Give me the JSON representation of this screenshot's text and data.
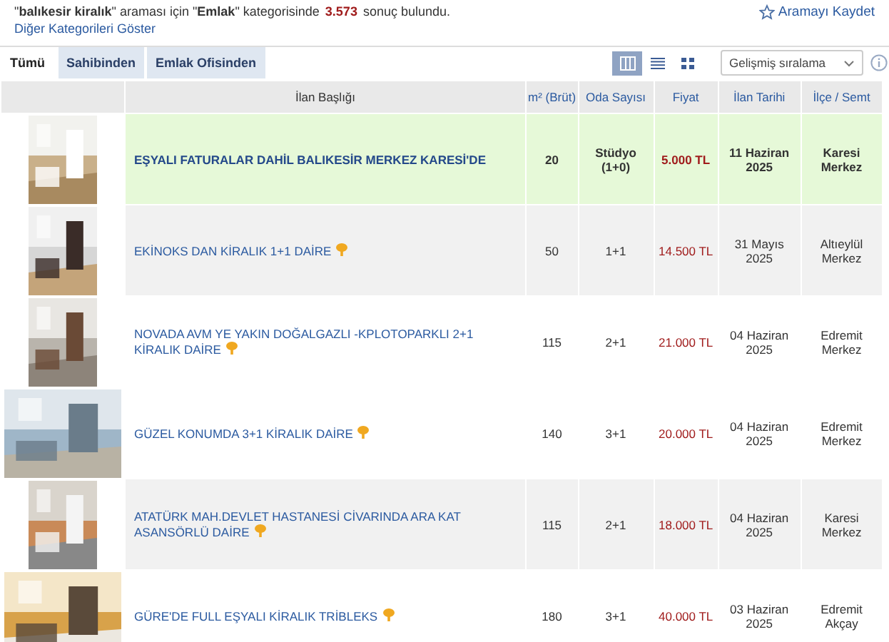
{
  "summary": {
    "text": "\"**balıkesir kiralık**\" araması için \"**Emlak**\" kategorisinde",
    "count": "3.573",
    "suffix": "sonuç bulundu.",
    "link": "Diğer Kategorileri Göster",
    "save": "Aramayı Kaydet"
  },
  "tabs": [
    {
      "label": "Tümü",
      "selected": true
    },
    {
      "label": "Sahibinden",
      "selected": false
    },
    {
      "label": "Emlak Ofisinden",
      "selected": false
    }
  ],
  "views": [
    {
      "kind": "table",
      "selected": true
    },
    {
      "kind": "list",
      "selected": false
    },
    {
      "kind": "grid",
      "selected": false
    }
  ],
  "sort": {
    "value": "Gelişmiş sıralama"
  },
  "table": {
    "columns": [
      "İlan Başlığı",
      "m² (Brüt)",
      "Oda Sayısı",
      "Fiyat",
      "İlan Tarihi",
      "İlçe / Semt"
    ],
    "rows": [
      {
        "featured": true,
        "title": "EŞYALI FATURALAR DAHİL BALIKESİR MERKEZ KARESİ'DE",
        "pinned": false,
        "area": "20",
        "rooms": "Stüdyo (1+0)",
        "price": "5.000 TL",
        "date": "11 Haziran 2025",
        "district": "Karesi Merkez"
      },
      {
        "featured": false,
        "shaded": true,
        "title": "EKİNOKS DAN KİRALIK 1+1 DAİRE",
        "pinned": true,
        "area": "50",
        "rooms": "1+1",
        "price": "14.500 TL",
        "date": "31 Mayıs 2025",
        "district": "Altıeylül Merkez"
      },
      {
        "featured": false,
        "shaded": false,
        "title": "NOVADA AVM YE YAKIN DOĞALGAZLI -KPLOTOPARKLI 2+1 KİRALIK DAİRE",
        "pinned": true,
        "area": "115",
        "rooms": "2+1",
        "price": "21.000 TL",
        "date": "04 Haziran 2025",
        "district": "Edremit Merkez"
      },
      {
        "featured": false,
        "shaded": false,
        "title": "GÜZEL KONUMDA 3+1 KİRALIK DAİRE",
        "pinned": true,
        "area": "140",
        "rooms": "3+1",
        "price": "20.000 TL",
        "date": "04 Haziran 2025",
        "district": "Edremit Merkez"
      },
      {
        "featured": false,
        "shaded": true,
        "title": "ATATÜRK MAH.DEVLET HASTANESİ CİVARINDA ARA KAT ASANSÖRLÜ DAİRE",
        "pinned": true,
        "area": "115",
        "rooms": "2+1",
        "price": "18.000 TL",
        "date": "04 Haziran 2025",
        "district": "Karesi Merkez"
      },
      {
        "featured": false,
        "shaded": false,
        "title": "GÜRE'DE FULL EŞYALI KİRALIK TRİBLEKS",
        "pinned": true,
        "area": "180",
        "rooms": "3+1",
        "price": "40.000 TL",
        "date": "03 Haziran 2025",
        "district": "Edremit Akçay"
      }
    ]
  }
}
